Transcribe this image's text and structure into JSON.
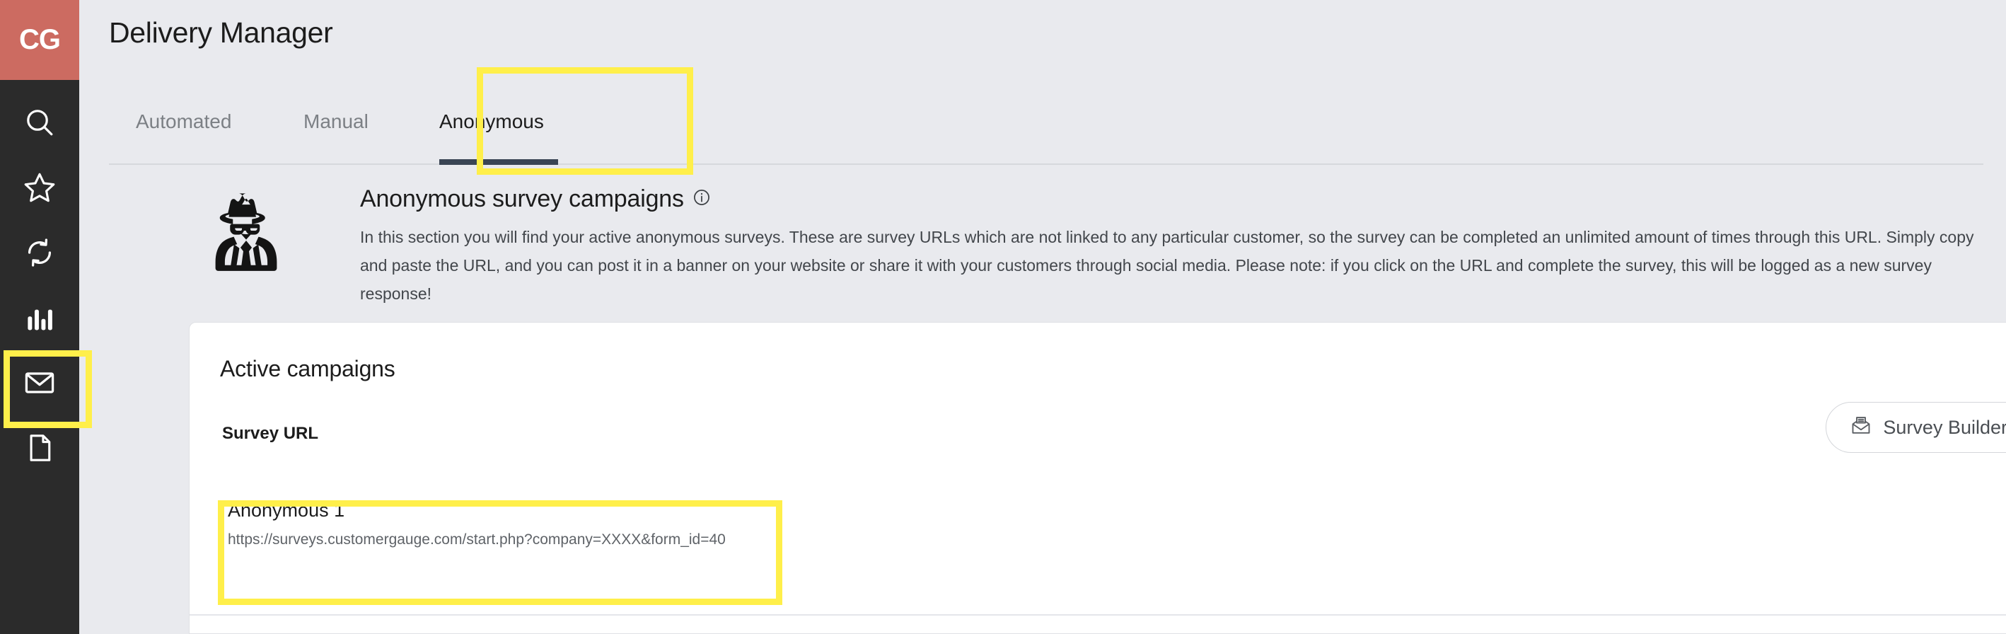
{
  "sidebar": {
    "logo": "CG",
    "logo_color": "#cc6b61",
    "background_color": "#2b2b2b",
    "items": [
      {
        "icon": "search-icon",
        "label": "Search"
      },
      {
        "icon": "star-icon",
        "label": "Favorites"
      },
      {
        "icon": "refresh-icon",
        "label": "Sync"
      },
      {
        "icon": "bar-chart-icon",
        "label": "Reports"
      },
      {
        "icon": "envelope-icon",
        "label": "Delivery Manager",
        "highlighted": true
      },
      {
        "icon": "document-icon",
        "label": "Documents"
      }
    ]
  },
  "header": {
    "title": "Delivery Manager"
  },
  "tabs": {
    "items": [
      {
        "label": "Automated",
        "active": false
      },
      {
        "label": "Manual",
        "active": false
      },
      {
        "label": "Anonymous",
        "active": true,
        "highlighted": true
      }
    ],
    "active_underline_color": "#3a4554"
  },
  "intro": {
    "icon": "spy-icon",
    "heading": "Anonymous survey campaigns",
    "info_icon": "info-circle-icon",
    "text": "In this section you will find your active anonymous surveys. These are survey URLs which are not linked to any particular customer, so the survey can be completed an unlimited amount of times through this URL. Simply copy and paste the URL, and you can post it in a banner on your website or share it with your customers through social media. Please note: if you click on the URL and complete the survey, this will be logged as a new survey response!"
  },
  "card": {
    "title": "Active campaigns",
    "collapse_icon": "minus-circle-icon",
    "column_header": "Survey URL",
    "survey_builder": {
      "label": "Survey Builder",
      "icon": "open-envelope-icon"
    },
    "campaigns": [
      {
        "name": "Anonymous 1",
        "url": "https://surveys.customergauge.com/start.php?company=XXXX&form_id=40",
        "highlighted": true
      }
    ]
  },
  "annotation": {
    "highlight_color": "#ffef4a"
  }
}
